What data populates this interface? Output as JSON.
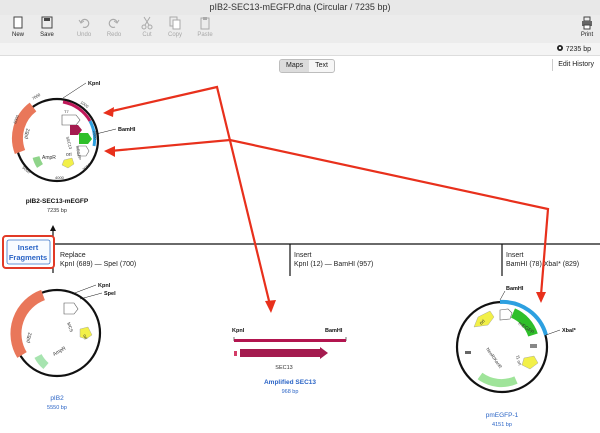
{
  "window": {
    "title": "pIB2-SEC13-mEGFP.dna  (Circular / 7235 bp)"
  },
  "toolbar": {
    "new": "New",
    "save": "Save",
    "undo": "Undo",
    "redo": "Redo",
    "cut": "Cut",
    "copy": "Copy",
    "paste": "Paste",
    "print": "Print"
  },
  "status": {
    "bp": "7235 bp"
  },
  "view_tabs": {
    "maps": "Maps",
    "text": "Text"
  },
  "edit_history": "Edit History",
  "result": {
    "name": "pIB2-SEC13-mEGFP",
    "size": "7235 bp",
    "site1": "KpnI",
    "site2": "BamHI",
    "features": [
      "pIB2",
      "AmpR",
      "ori",
      "SEC13",
      "mEGFP",
      "T7"
    ],
    "ticks": [
      "1000",
      "2000",
      "3000",
      "4000",
      "5000",
      "6000",
      "7000"
    ]
  },
  "insert_button": "Insert\nFragments",
  "steps": [
    {
      "title": "Replace",
      "detail": "KpnI (689) — SpeI (700)"
    },
    {
      "title": "Insert",
      "detail": "KpnI (12) — BamHI (957)"
    },
    {
      "title": "Insert",
      "detail": "BamHI (78)   XbaI* (829)"
    }
  ],
  "backbone": {
    "name": "pIB2",
    "size": "5550 bp",
    "site1": "KpnI",
    "site2": "SpeI",
    "features": [
      "pIB2",
      "AmpR",
      "MCS",
      "ori"
    ]
  },
  "fragment": {
    "name": "Amplified SEC13",
    "size": "968 bp",
    "site1": "KpnI",
    "site2": "BamHI",
    "feature": "SEC13"
  },
  "donor": {
    "name": "pmEGFP-1",
    "size": "4151 bp",
    "site1": "BamHI",
    "site2": "XbaI*",
    "features": [
      "ori",
      "mEGFP",
      "f1 ori",
      "NeoR/KanR"
    ]
  }
}
